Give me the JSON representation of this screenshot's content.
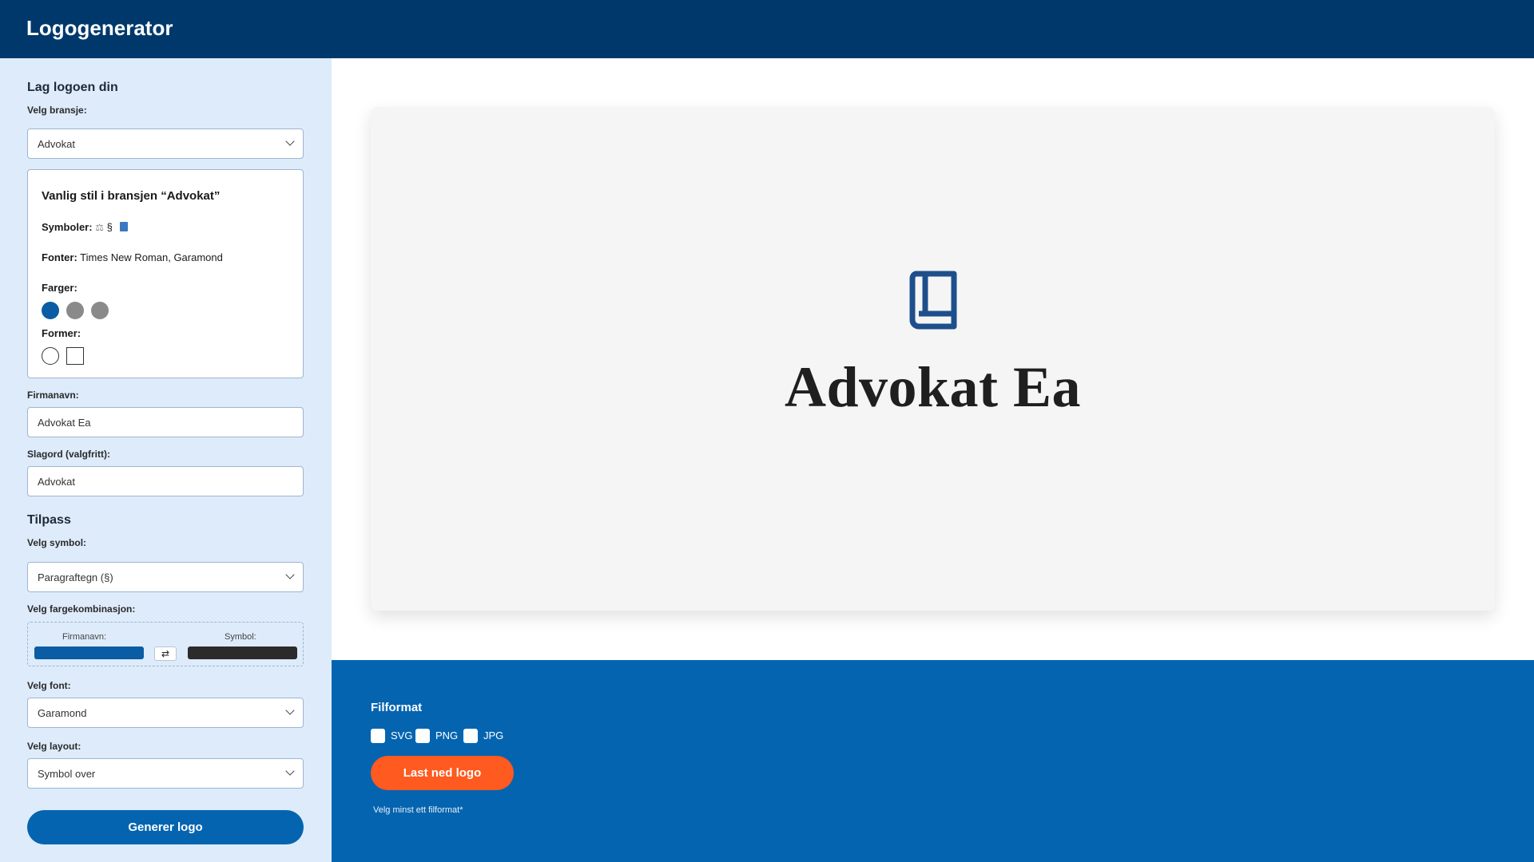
{
  "header": {
    "title": "Logogenerator"
  },
  "sidebar": {
    "heading": "Lag logoen din",
    "industry_label": "Velg bransje:",
    "industry_value": "Advokat",
    "style_box": {
      "title": "Vanlig stil i bransjen “Advokat”",
      "symbols_label": "Symboler:",
      "symbols_text": "§",
      "fonts_label": "Fonter:",
      "fonts_value": "Times New Roman, Garamond",
      "colors_label": "Farger:",
      "colors": [
        "#0a5ca4",
        "#8a8a8a",
        "#8a8a8a"
      ],
      "shapes_label": "Former:"
    },
    "company_label": "Firmanavn:",
    "company_value": "Advokat Ea",
    "slogan_label": "Slagord (valgfritt):",
    "slogan_value": "Advokat",
    "customize_heading": "Tilpass",
    "symbol_label": "Velg symbol:",
    "symbol_value": "Paragraftegn (§)",
    "colorcombo_label": "Velg fargekombinasjon:",
    "colorcombo": {
      "company_label": "Firmanavn:",
      "symbol_label": "Symbol:",
      "company_color": "#0a5ca4",
      "symbol_color": "#2b2b2b",
      "swap_glyph": "⇄"
    },
    "font_label": "Velg font:",
    "font_value": "Garamond",
    "layout_label": "Velg layout:",
    "layout_value": "Symbol over",
    "generate_button": "Generer logo"
  },
  "preview": {
    "icon": "book-icon",
    "icon_color": "#1e4f8c",
    "company_name": "Advokat Ea"
  },
  "download": {
    "heading": "Filformat",
    "formats": [
      "SVG",
      "PNG",
      "JPG"
    ],
    "button": "Last ned logo",
    "hint": "Velg minst ett filformat*"
  }
}
